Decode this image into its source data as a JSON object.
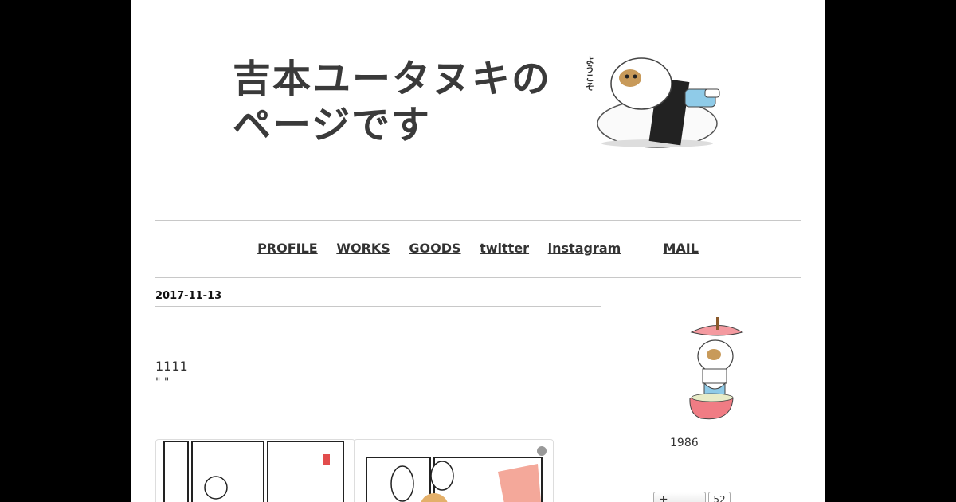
{
  "header": {
    "title_line1": "吉本ユータヌキの",
    "title_line2": "ページです",
    "welcome": "ようこそ"
  },
  "nav": {
    "items": [
      "PROFILE",
      "WORKS",
      "GOODS",
      "twitter",
      "instagram",
      "MAIL"
    ]
  },
  "post": {
    "date": "2017-11-13",
    "text": "1111",
    "quote": "\"  \""
  },
  "sidebar": {
    "text": "1986",
    "bookmark_icon": "+",
    "bookmark_count": "52"
  }
}
